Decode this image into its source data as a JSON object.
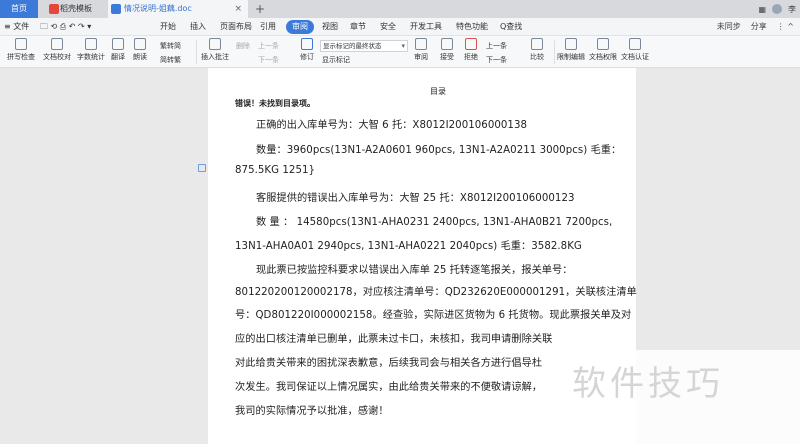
{
  "titlebar": {
    "home_tab": "首页",
    "tabs": [
      {
        "label": "稻壳模板"
      },
      {
        "label": "情况说明-姐藕.doc"
      }
    ],
    "new_tab": "+",
    "user_name": "李"
  },
  "menubar": {
    "file": "≡ 文件",
    "items": [
      "开始",
      "插入",
      "页面布局",
      "引用",
      "审阅",
      "视图",
      "章节",
      "安全",
      "开发工具",
      "特色功能"
    ],
    "active": "审阅",
    "search": "Q查找",
    "sync": "未同步",
    "share": "分享"
  },
  "toolbar": {
    "spellcheck": "拼写检查",
    "doc_proof": "文档校对",
    "word_count": "字数统计",
    "translate": "翻译",
    "read": "朗读",
    "trad_to_simp": "繁转简",
    "simp_to_trad": "简转繁",
    "insert_comment": "插入批注",
    "delete": "删除",
    "prev": "上一条",
    "next": "下一条",
    "track_changes": "修订",
    "display_mode": "显示标记的最终状态",
    "show_marks": "显示标记",
    "review": "审阅",
    "accept": "接受",
    "reject": "拒绝",
    "prev2": "上一条",
    "next2": "下一条",
    "compare": "比较",
    "restrict_edit": "限制编辑",
    "doc_permission": "文档权限",
    "doc_auth": "文档认证"
  },
  "document": {
    "toc_title": "目录",
    "toc_error": "错误！未找到目录项。",
    "lines": [
      "正确的出入库单号为：大智 6 托：X8012I200106000138",
      "数量：3960pcs(13N1-A2A0601 960pcs, 13N1-A2A0211 3000pcs)     毛重：",
      "875.5KG    1251}",
      "客服提供的错误出入库单号为：大智 25 托：X8012I200106000123",
      "数  量 ：  14580pcs(13N1-AHA0231   2400pcs,   13N1-AHA0B21   7200pcs,",
      "13N1-AHA0A01 2940pcs, 13N1-AHA0221 2040pcs)        毛重：3582.8KG",
      "现此票已按监控科要求以错误出入库单 25 托转逐笔报关，报关单号：",
      "801220200120002178，对应核注清单号：QD232620E000001291，关联核注清单",
      "号：QD801220I000002158。经查验，实际进区货物为 6 托货物。现此票报关单及对",
      "应的出口核注清单已删单，此票未过卡口，未核扣，我司申请删除关联",
      "对此给贵关带来的困扰深表歉意，后续我司会与相关各方进行倡导杜",
      "次发生。我司保证以上情况属实，由此给贵关带来的不便敬请谅解，",
      "我司的实际情况予以批准，感谢！"
    ]
  },
  "watermark": "软件技巧",
  "colors": {
    "accent": "#3b7ad8",
    "page_bg": "#ffffff",
    "workspace_bg": "#e9e9e9"
  }
}
